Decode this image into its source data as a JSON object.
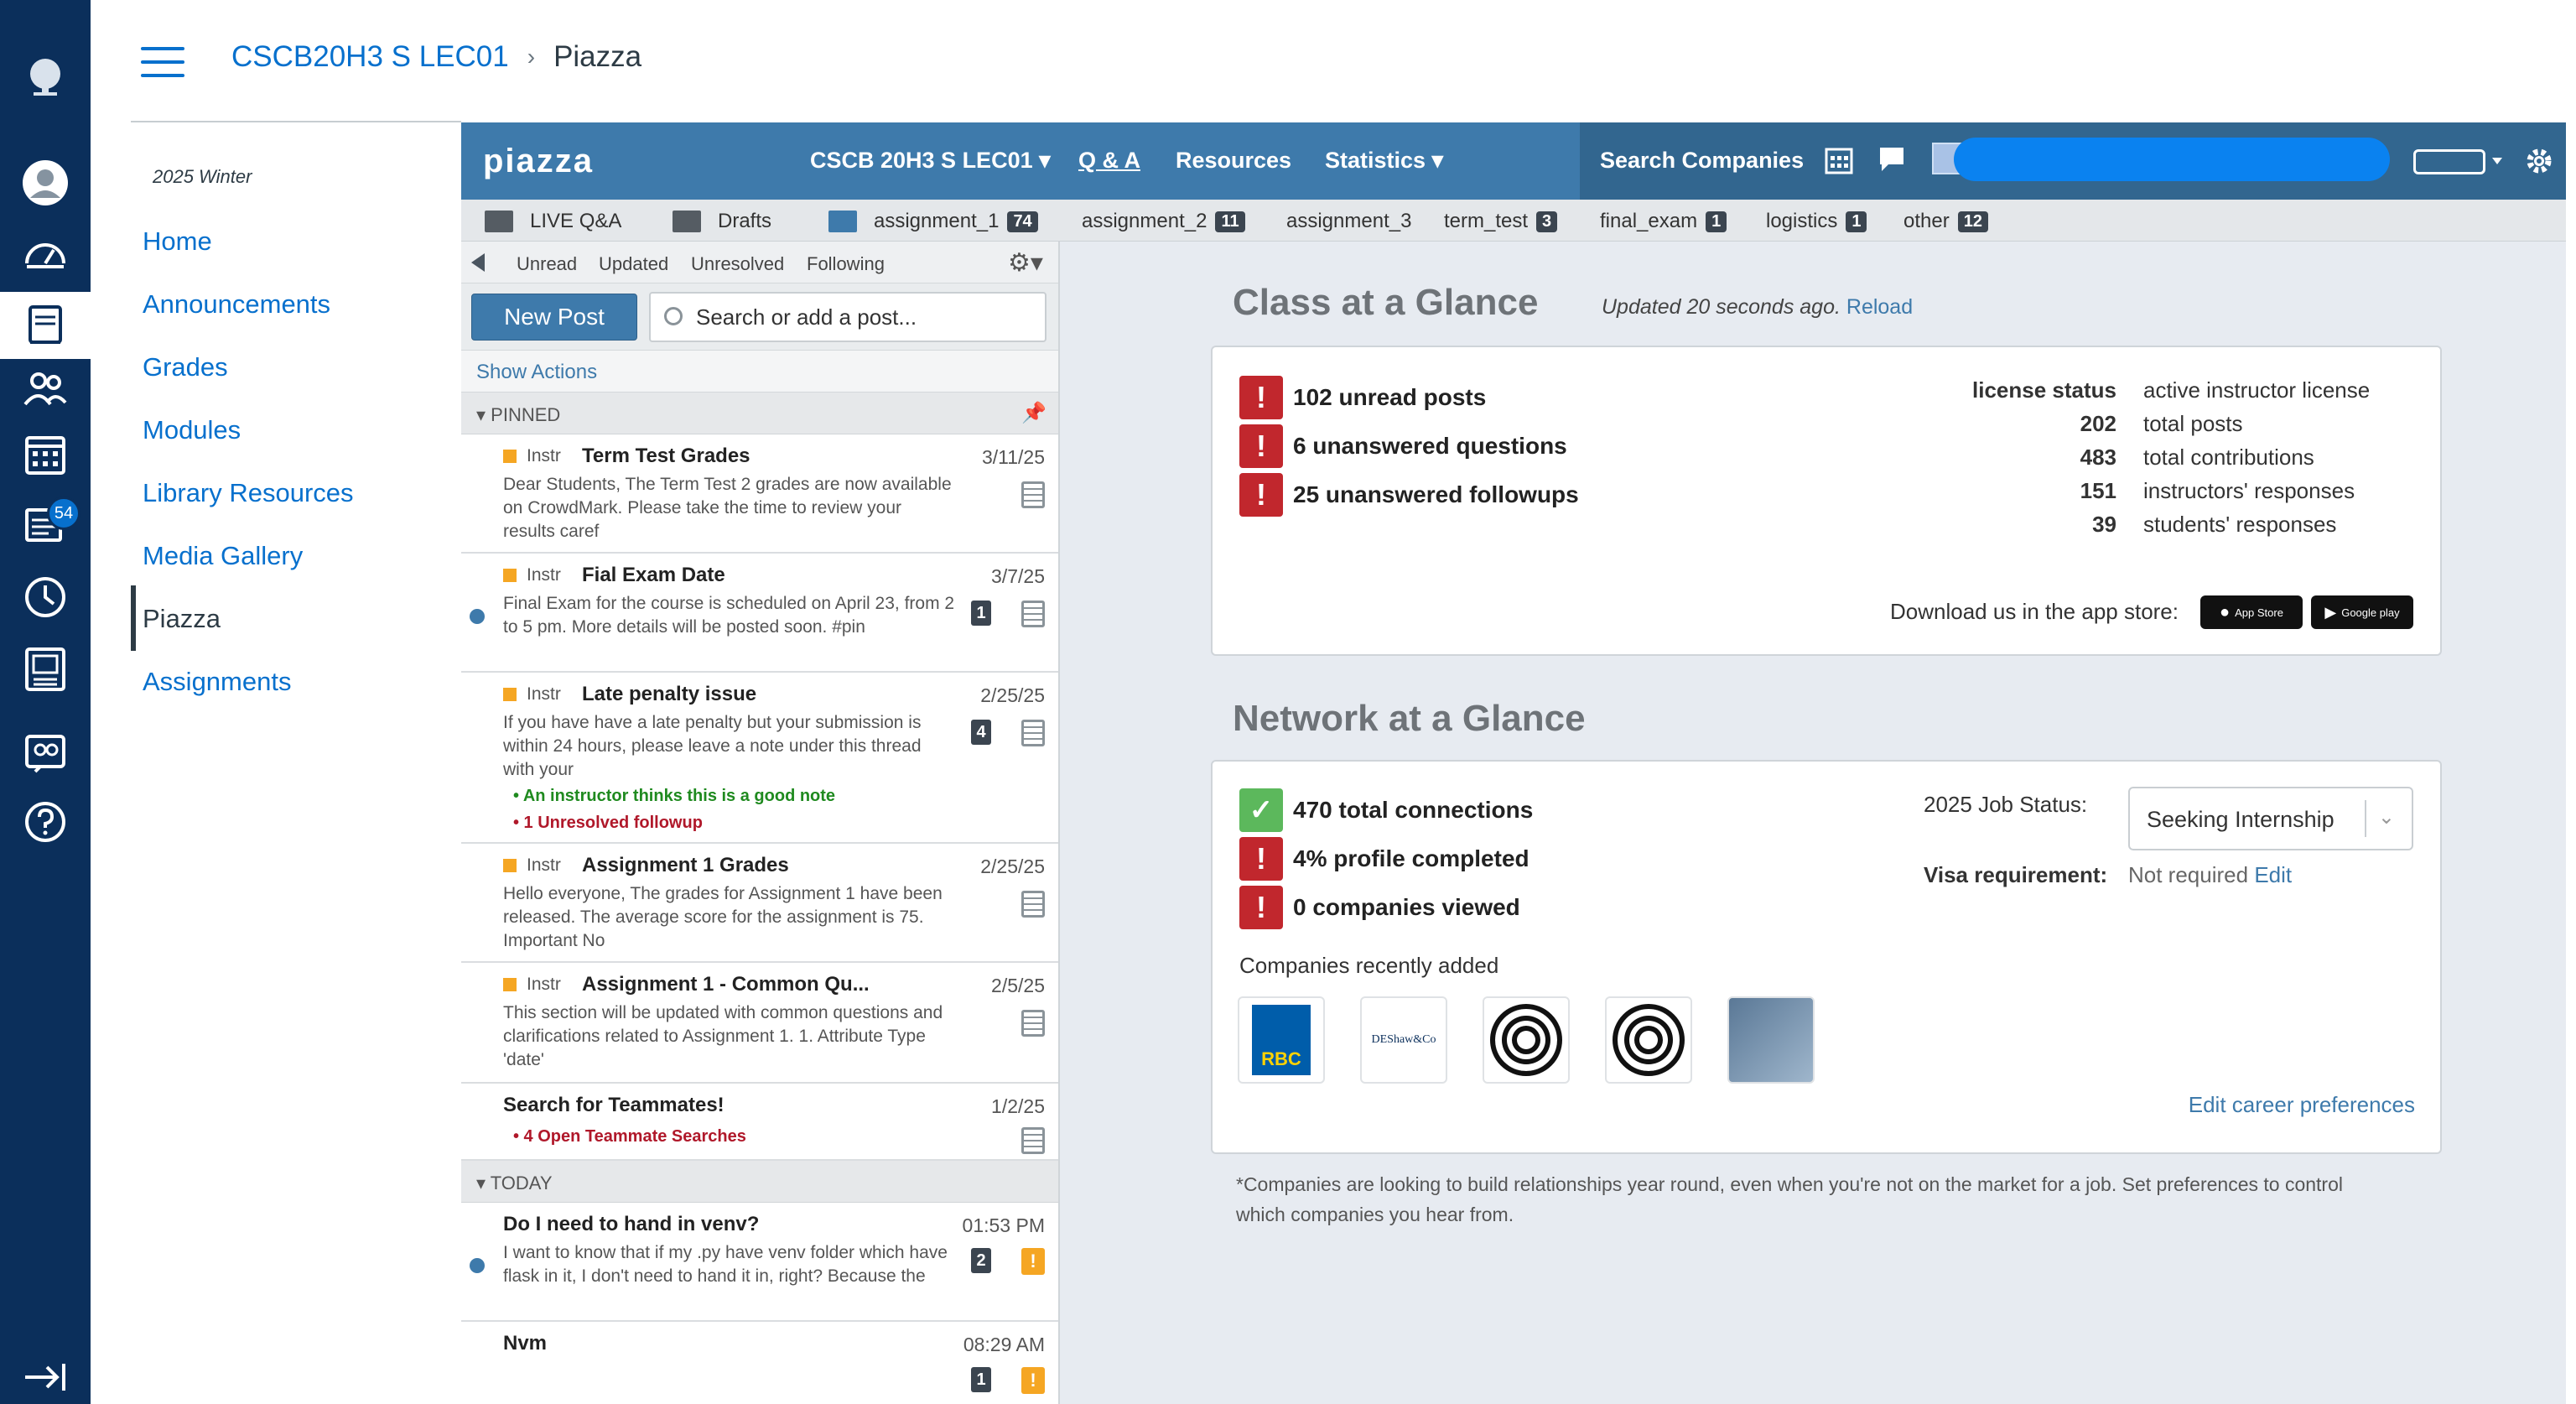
{
  "header": {
    "course": "CSCB20H3 S LEC01",
    "separator": "›",
    "page": "Piazza"
  },
  "global_nav": {
    "inbox_badge": "54",
    "icons": [
      "university-logo-icon",
      "account-icon",
      "dashboard-icon",
      "courses-icon",
      "groups-icon",
      "calendar-icon",
      "inbox-icon",
      "history-icon",
      "studio-icon",
      "commons-icon",
      "help-icon",
      "collapse-nav-icon"
    ]
  },
  "course_nav": {
    "term": "2025 Winter",
    "items": [
      "Home",
      "Announcements",
      "Grades",
      "Modules",
      "Library Resources",
      "Media Gallery",
      "Piazza",
      "Assignments"
    ],
    "active": "Piazza"
  },
  "piazza": {
    "logo": "piazza",
    "class_dropdown": "CSCB 20H3 S LEC01 ▾",
    "nav": {
      "qa": "Q & A",
      "resources": "Resources",
      "statistics": "Statistics ▾"
    },
    "search_companies": "Search Companies",
    "folders": [
      {
        "label": "LIVE Q&A",
        "count": ""
      },
      {
        "label": "Drafts",
        "count": ""
      },
      {
        "label": "assignment_1",
        "count": "74"
      },
      {
        "label": "assignment_2",
        "count": "11"
      },
      {
        "label": "assignment_3",
        "count": ""
      },
      {
        "label": "term_test",
        "count": "3"
      },
      {
        "label": "final_exam",
        "count": "1"
      },
      {
        "label": "logistics",
        "count": "1"
      },
      {
        "label": "other",
        "count": "12"
      }
    ],
    "filters": [
      "Unread",
      "Updated",
      "Unresolved",
      "Following"
    ],
    "new_post": "New Post",
    "search_placeholder": "Search or add a post...",
    "show_actions": "Show Actions",
    "sections": {
      "pinned": "▾ PINNED",
      "today": "▾ TODAY"
    },
    "posts": [
      {
        "tag": "Instr",
        "title": "Term Test Grades",
        "date": "3/11/25",
        "body": "Dear Students, The Term Test 2 grades are now available on CrowdMark. Please take the time to review your results caref",
        "count": ""
      },
      {
        "tag": "Instr",
        "title": "Fial Exam Date",
        "date": "3/7/25",
        "body": "Final Exam for the course is scheduled on April 23, from 2 to 5 pm. More details will be posted soon. #pin",
        "count": "1"
      },
      {
        "tag": "Instr",
        "title": "Late penalty issue",
        "date": "2/25/25",
        "body": "If you have have a late penalty but your submission is within 24 hours, please leave a note under this thread with your",
        "count": "4",
        "note_good": "• An instructor thinks this is a good note",
        "note_unresolved": "• 1 Unresolved followup"
      },
      {
        "tag": "Instr",
        "title": "Assignment 1 Grades",
        "date": "2/25/25",
        "body": "Hello everyone, The grades for Assignment 1 have been released. The average score for the assignment is 75. Important No",
        "count": ""
      },
      {
        "tag": "Instr",
        "title": "Assignment 1 - Common Qu...",
        "date": "2/5/25",
        "body": "This section will be updated with common questions and clarifications related to Assignment 1. 1. Attribute Type 'date'",
        "count": ""
      },
      {
        "tag": "",
        "title": "Search for Teammates!",
        "date": "1/2/25",
        "body": "",
        "count": "",
        "note_unresolved": "• 4 Open Teammate Searches"
      },
      {
        "tag": "",
        "title": "Do I need to hand in venv?",
        "date": "01:53 PM",
        "body": "I want to know that if my .py have venv folder which have flask in it, I don't need to hand it in, right? Because the",
        "count": "2"
      },
      {
        "tag": "",
        "title": "Nvm",
        "date": "08:29 AM",
        "body": "",
        "count": "1"
      }
    ]
  },
  "class_glance": {
    "title": "Class at a Glance",
    "updated": "Updated 20 seconds ago.",
    "reload": "Reload",
    "alerts": [
      "102 unread posts",
      "6 unanswered questions",
      "25 unanswered followups"
    ],
    "stats": [
      {
        "k": "license status",
        "v": "active instructor license"
      },
      {
        "k": "202",
        "v": "total posts"
      },
      {
        "k": "483",
        "v": "total contributions"
      },
      {
        "k": "151",
        "v": "instructors' responses"
      },
      {
        "k": "39",
        "v": "students' responses"
      }
    ],
    "download_text": "Download us in the app store:",
    "app_store": "App Store",
    "google_play": "Google play"
  },
  "network_glance": {
    "title": "Network at a Glance",
    "connections": "470 total connections",
    "profile": "4% profile completed",
    "companies_viewed": "0 companies viewed",
    "job_status_label": "2025 Job Status:",
    "job_status_value": "Seeking Internship",
    "visa_label": "Visa requirement:",
    "visa_value": "Not required",
    "visa_edit": "Edit",
    "companies_label": "Companies recently added",
    "company_logos": [
      "RBC",
      "DEShaw&Co"
    ],
    "edit_career": "Edit career preferences",
    "footnote": "*Companies are looking to build relationships year round, even when you're not on the market for a job. Set preferences to control which companies you hear from."
  }
}
